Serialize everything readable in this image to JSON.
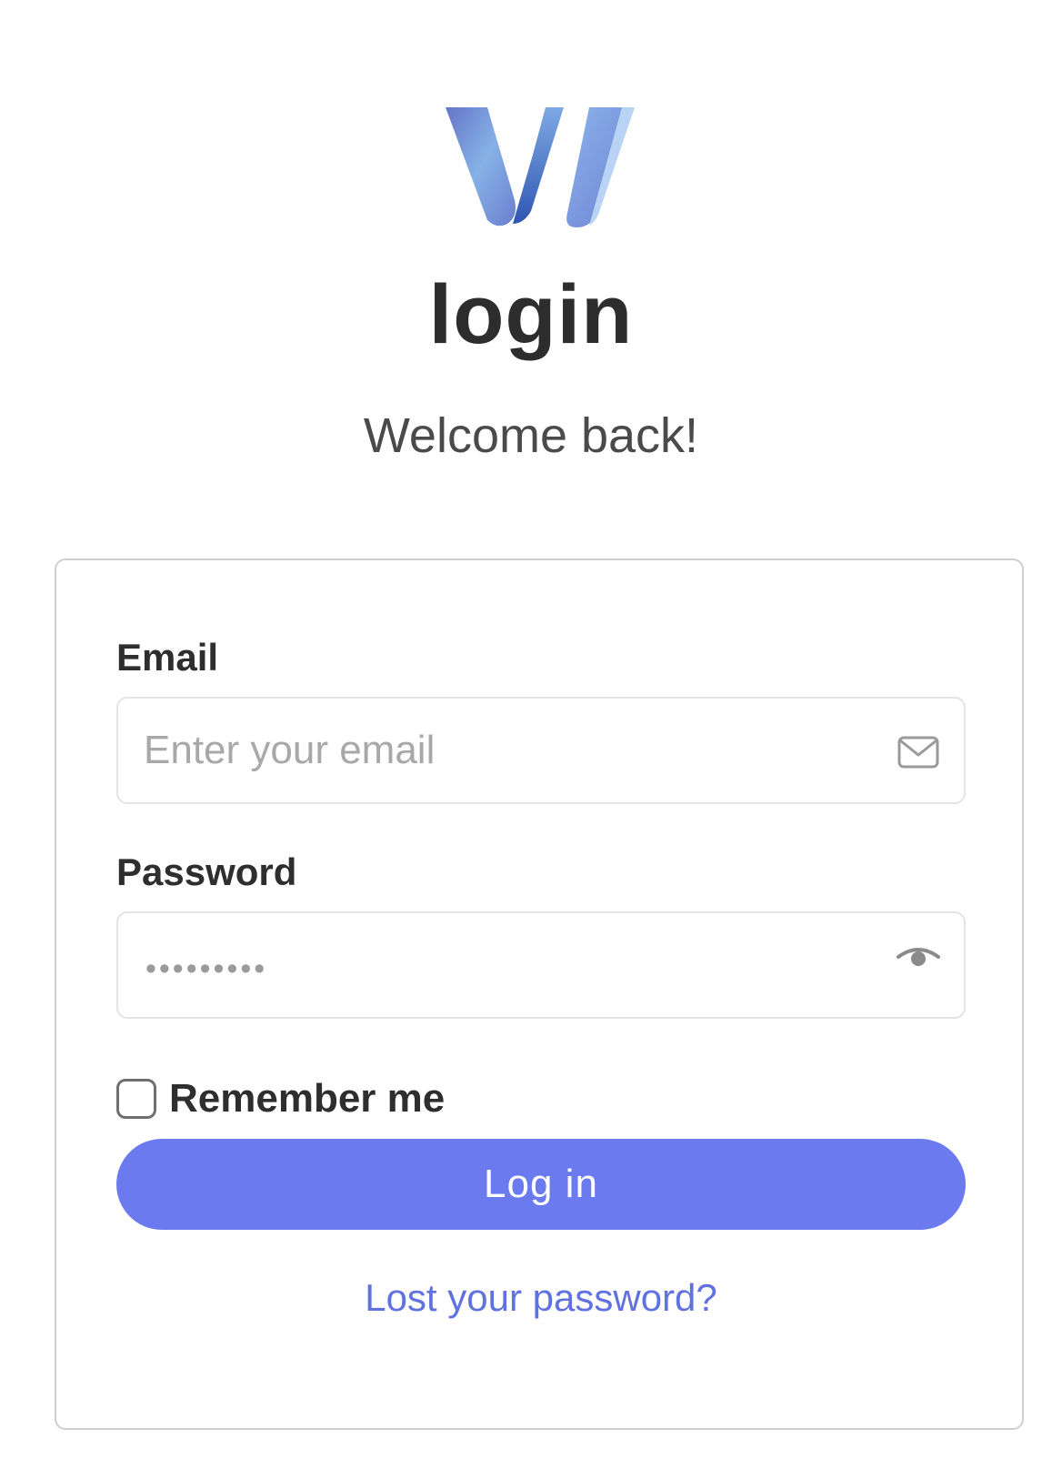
{
  "header": {
    "title": "login",
    "subtitle": "Welcome back!"
  },
  "form": {
    "email_label": "Email",
    "email_placeholder": "Enter your email",
    "password_label": "Password",
    "password_value": "•••••••••",
    "remember_label": "Remember me",
    "remember_checked": false,
    "login_label": "Log in",
    "lost_password_label": "Lost your password?"
  },
  "icons": {
    "logo": "w-logo-icon",
    "email_field": "envelope-icon",
    "password_field": "eye-icon"
  },
  "colors": {
    "primary": "#6b7bef",
    "link": "#6071e0",
    "heading": "#2d2d2d"
  }
}
